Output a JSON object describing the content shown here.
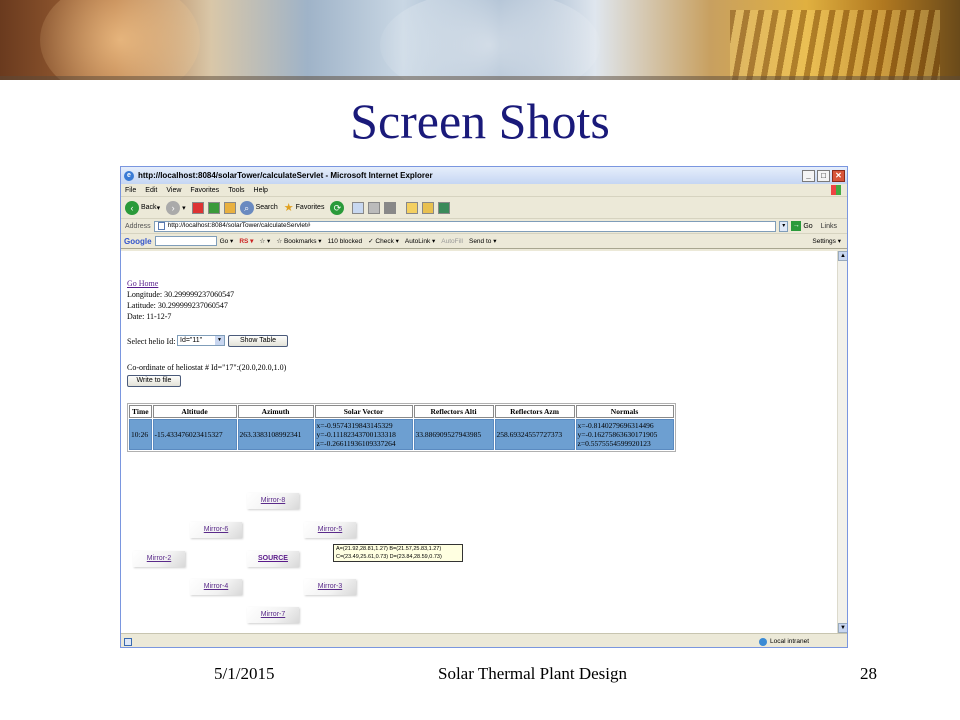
{
  "slide": {
    "title": "Screen Shots",
    "footer_date": "5/1/2015",
    "footer_title": "Solar Thermal Plant Design",
    "footer_page": "28"
  },
  "browser": {
    "window_title": "http://localhost:8084/solarTower/calculateServlet - Microsoft Internet Explorer",
    "menu": [
      "File",
      "Edit",
      "View",
      "Favorites",
      "Tools",
      "Help"
    ],
    "toolbar": {
      "back": "Back",
      "search": "Search",
      "favorites": "Favorites"
    },
    "address_label": "Address",
    "address_value": "http://localhost:8084/solarTower/calculateServlet#",
    "go_label": "Go",
    "links_label": "Links",
    "google": {
      "logo": "Google",
      "go": "Go",
      "bookmarks": "Bookmarks",
      "blocked": "110 blocked",
      "check": "Check",
      "autolink": "AutoLink",
      "autofill": "AutoFill",
      "send_to": "Send to",
      "settings": "Settings"
    },
    "status_zone": "Local intranet"
  },
  "page": {
    "go_home": "Go Home",
    "longitude": "Longitude: 30.299999237060547",
    "latitude": "Latitude: 30.299999237060547",
    "date": "Date: 11-12-7",
    "select_label": "Select helio Id:",
    "select_value": "Id=\"11\"",
    "show_table": "Show Table",
    "coordinate_text": "Co-ordinate of heliostat # Id=\"17\":(20.0,20.0,1.0)",
    "write_to_file": "Write to file"
  },
  "table": {
    "headers": [
      "Time",
      "Altitude",
      "Azimuth",
      "Solar Vector",
      "Reflectors Alti",
      "Reflectors Azm",
      "Normals"
    ],
    "row": {
      "time": "10:26",
      "altitude": "-15.433476023415327",
      "azimuth": "263.3383108992341",
      "solar_vector": [
        "x=-0.9574319843145329",
        "y=-0.11182343700133318",
        "z=-0.26611936109337264"
      ],
      "reflectors_alti": "33.886909527943985",
      "reflectors_azm": "258.69324557727373",
      "normals": [
        "x=-0.8140279696314496",
        "y=-0.16275863630171905",
        "z=0.5575554599920123"
      ]
    }
  },
  "mirrors": {
    "m8": "Mirror-8",
    "m6": "Mirror-6",
    "m5": "Mirror-5",
    "m2": "Mirror-2",
    "source": "SOURCE",
    "m4": "Mirror-4",
    "m3": "Mirror-3",
    "m7": "Mirror-7"
  },
  "tooltip": {
    "line1": "A=(21.92,28.81,1.27) B=(21.57,25.83,1.27)",
    "line2": "C=(23.49,25.61,0.73) D=(23.84,28.59,0.73)"
  }
}
